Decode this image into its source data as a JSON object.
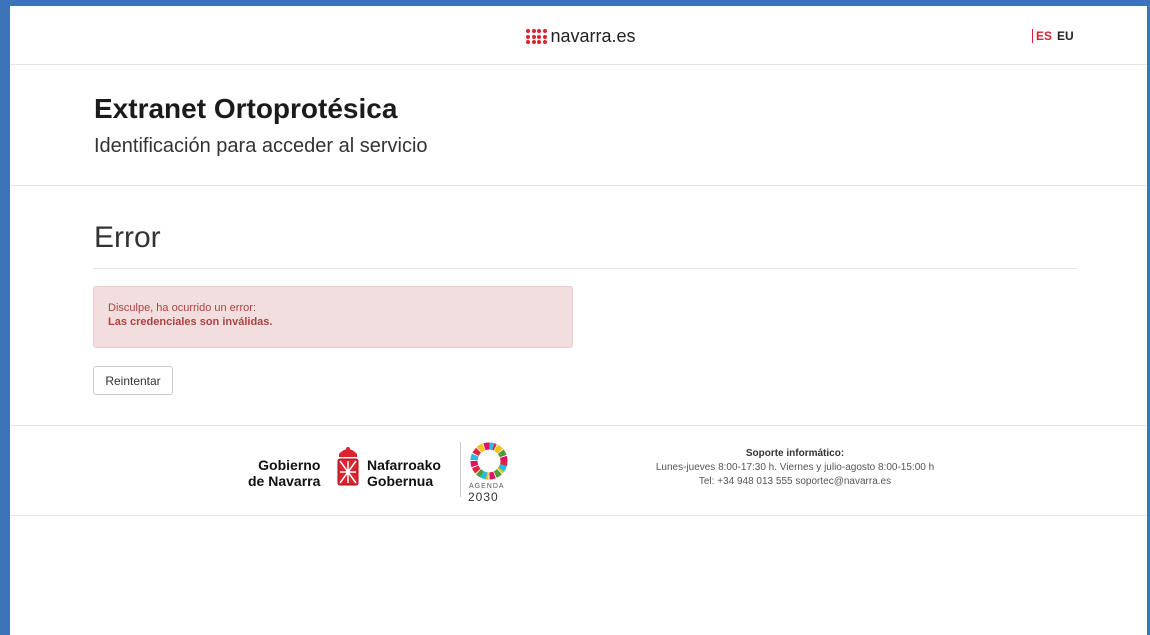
{
  "header": {
    "brand": "navarra.es",
    "languages": {
      "es": "ES",
      "eu": "EU"
    },
    "accent_color": "#d9232e"
  },
  "title_section": {
    "title": "Extranet Ortoprotésica",
    "subtitle": "Identificación para acceder al servicio"
  },
  "main": {
    "heading": "Error",
    "alert": {
      "line1": "Disculpe, ha ocurrido un error:",
      "line2": "Las credenciales son inválidas.",
      "color": "#a94442",
      "background": "#f2dedf"
    },
    "retry_label": "Reintentar"
  },
  "footer": {
    "gobierno_left_1": "Gobierno",
    "gobierno_left_2": "de Navarra",
    "gobierno_right_1": "Nafarroako",
    "gobierno_right_2": "Gobernua",
    "agenda_label": "AGENDA",
    "agenda_year": "2030",
    "support": {
      "title": "Soporte informático:",
      "hours": "Lunes-jueves 8:00-17:30 h. Viernes y julio-agosto 8:00-15:00 h",
      "contact": "Tel: +34 948 013 555 soportec@navarra.es"
    }
  },
  "window": {
    "frame_color": "#3d73b8"
  }
}
